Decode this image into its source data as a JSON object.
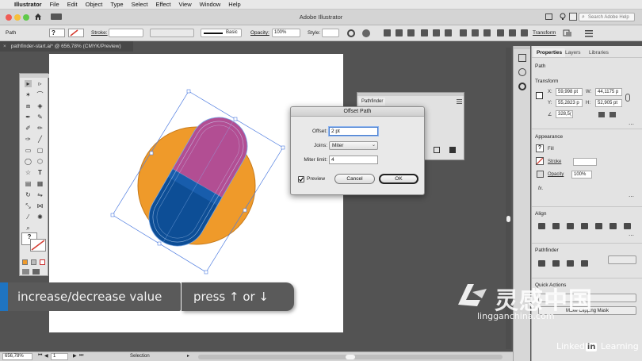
{
  "menubar": {
    "app_name": "Illustrator",
    "items": [
      "File",
      "Edit",
      "Object",
      "Type",
      "Select",
      "Effect",
      "View",
      "Window",
      "Help"
    ]
  },
  "titlebar": {
    "title": "Adobe Illustrator",
    "search_placeholder": "Search Adobe Help"
  },
  "controlbar": {
    "selection_type": "Path",
    "stroke_label": "Stroke:",
    "brush_label": "Basic",
    "opacity_label": "Opacity:",
    "opacity_value": "100%",
    "style_label": "Style:",
    "transform_label": "Transform"
  },
  "document": {
    "tab_title": "pathfinder-start.ai* @ 656,78% (CMYK/Preview)"
  },
  "pathfinder_float": {
    "title": "Pathfinder"
  },
  "dialog": {
    "title": "Offset Path",
    "offset_label": "Offset:",
    "offset_value": "2 pt",
    "joins_label": "Joins:",
    "joins_value": "Miter",
    "miter_label": "Miter limit:",
    "miter_value": "4",
    "preview_label": "Preview",
    "preview_checked": true,
    "cancel_label": "Cancel",
    "ok_label": "OK"
  },
  "right_panel": {
    "tabs": [
      "Properties",
      "Layers",
      "Libraries"
    ],
    "active_tab": "Properties",
    "section_path": "Path",
    "transform_title": "Transform",
    "x_value": "59,998 pt",
    "y_value": "55,2823 p",
    "w_value": "44,1175 p",
    "h_value": "52,905 pt",
    "angle_value": "328,5(",
    "x_label": "X:",
    "y_label": "Y:",
    "w_label": "W:",
    "h_label": "H:",
    "appearance_title": "Appearance",
    "fill_label": "Fill",
    "stroke_label": "Stroke",
    "opacity_label": "Opacity",
    "opacity_value": "100%",
    "fx_label": "fx.",
    "align_title": "Align",
    "pathfinder_title": "Pathfinder",
    "quick_actions_title": "Quick Actions",
    "clipping_mask_label": "Make Clipping Mask"
  },
  "statusbar": {
    "zoom": "656,78%",
    "artboard": "1",
    "tool": "Selection"
  },
  "hint_overlay": {
    "left_text": "increase/decrease value",
    "right_text": "press ↑ or ↓"
  },
  "watermark": {
    "cn_text": "灵感中国",
    "url": "lingganchina.com"
  },
  "linkedin": {
    "pre": "Linked",
    "in": "in",
    "post": " Learning"
  },
  "colors": {
    "orange_circle": "#ef9a2a",
    "pill_top": "#b24e93",
    "pill_bottom": "#0d4e96",
    "accent_blue": "#1f74c1"
  }
}
